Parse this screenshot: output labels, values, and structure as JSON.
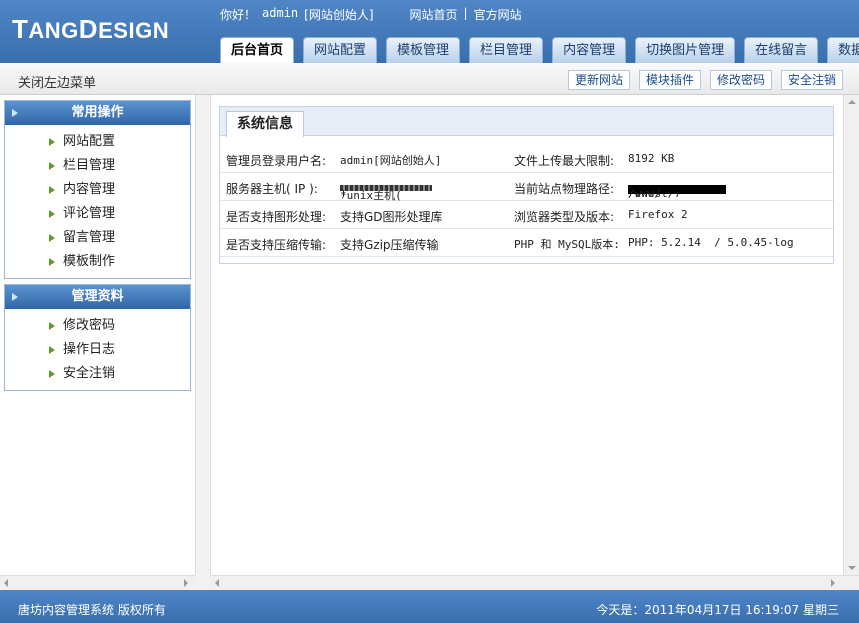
{
  "logo": {
    "text": "TangDesign"
  },
  "welcome": {
    "greeting": "你好！",
    "user": "admin",
    "role": "[网站创始人]",
    "links": [
      "网站首页",
      "|",
      "官方网站"
    ]
  },
  "tabs": [
    "后台首页",
    "网站配置",
    "模板管理",
    "栏目管理",
    "内容管理",
    "切换图片管理",
    "在线留言",
    "数据备份"
  ],
  "active_tab": "后台首页",
  "toolbar": {
    "close_menu": "关闭左边菜单",
    "buttons": [
      "更新网站",
      "模块插件",
      "修改密码",
      "安全注销"
    ]
  },
  "sidebar": {
    "sections": [
      {
        "title": "常用操作",
        "items": [
          "网站配置",
          "栏目管理",
          "内容管理",
          "评论管理",
          "留言管理",
          "模板制作"
        ]
      },
      {
        "title": "管理资料",
        "items": [
          "修改密码",
          "操作日志",
          "安全注销"
        ]
      }
    ]
  },
  "panel": {
    "title": "系统信息",
    "rows": [
      {
        "l1": "管理员登录用户名:",
        "v1": "admin[网站创始人]",
        "l2": "文件上传最大限制:",
        "v2": "8192 KB"
      },
      {
        "l1": "服务器主机( IP ):",
        "v1_prefix": "*unix主机(",
        "v1_suffix": ")",
        "l2": "当前站点物理路径:",
        "v2_prefix": "/vhost/7",
        "v2_suffix": "/www/"
      },
      {
        "l1": "是否支持图形处理:",
        "v1": "支持GD图形处理库",
        "l2": "浏览器类型及版本:",
        "v2": "Firefox 2"
      },
      {
        "l1": "是否支持压缩传输:",
        "v1": "支持Gzip压缩传输",
        "l2": "PHP 和 MySQL版本:",
        "v2": "PHP: 5.2.14  / 5.0.45-log"
      }
    ]
  },
  "footer": {
    "copyright": "唐坊内容管理系统 版权所有",
    "date": "今天是：2011年04月17日 16:19:07 星期三"
  }
}
